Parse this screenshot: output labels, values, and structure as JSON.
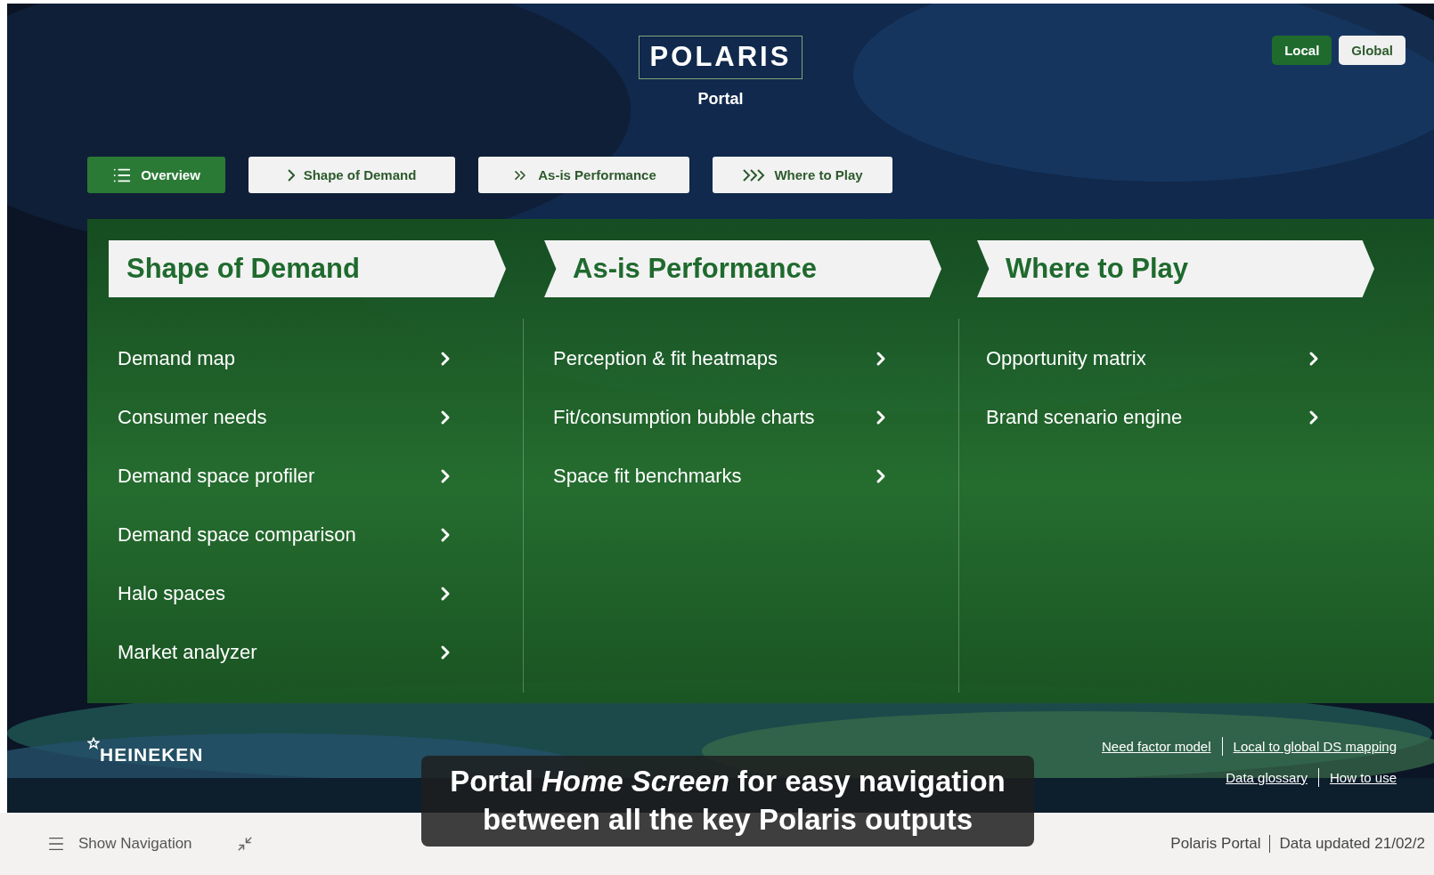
{
  "header": {
    "logo": "POLARIS",
    "subtitle": "Portal",
    "scope_toggle": [
      {
        "label": "Local",
        "selected": true
      },
      {
        "label": "Global",
        "selected": false
      }
    ]
  },
  "nav_buttons": [
    {
      "label": "Overview",
      "kind": "list",
      "selected": true
    },
    {
      "label": "Shape of Demand",
      "kind": "single",
      "selected": false
    },
    {
      "label": "As-is Performance",
      "kind": "double",
      "selected": false
    },
    {
      "label": "Where to Play",
      "kind": "triple",
      "selected": false
    }
  ],
  "sections": [
    {
      "title": "Shape of Demand",
      "items": [
        "Demand map",
        "Consumer needs",
        "Demand space profiler",
        "Demand space comparison",
        "Halo spaces",
        "Market analyzer"
      ]
    },
    {
      "title": "As-is Performance",
      "items": [
        "Perception & fit heatmaps",
        "Fit/consumption bubble charts",
        "Space fit benchmarks"
      ]
    },
    {
      "title": "Where to Play",
      "items": [
        "Opportunity matrix",
        "Brand scenario engine"
      ]
    }
  ],
  "footer": {
    "brand": "HEINEKEN",
    "link_rows": [
      [
        "Need factor model",
        "Local to global DS mapping"
      ],
      [
        "Data glossary",
        "How to use"
      ]
    ]
  },
  "caption": "Portal *Home Screen* for easy navigation between all the key Polaris outputs",
  "status_bar": {
    "show_navigation": "Show Navigation",
    "report": "Polaris Portal",
    "updated": "Data updated 21/02/2"
  }
}
